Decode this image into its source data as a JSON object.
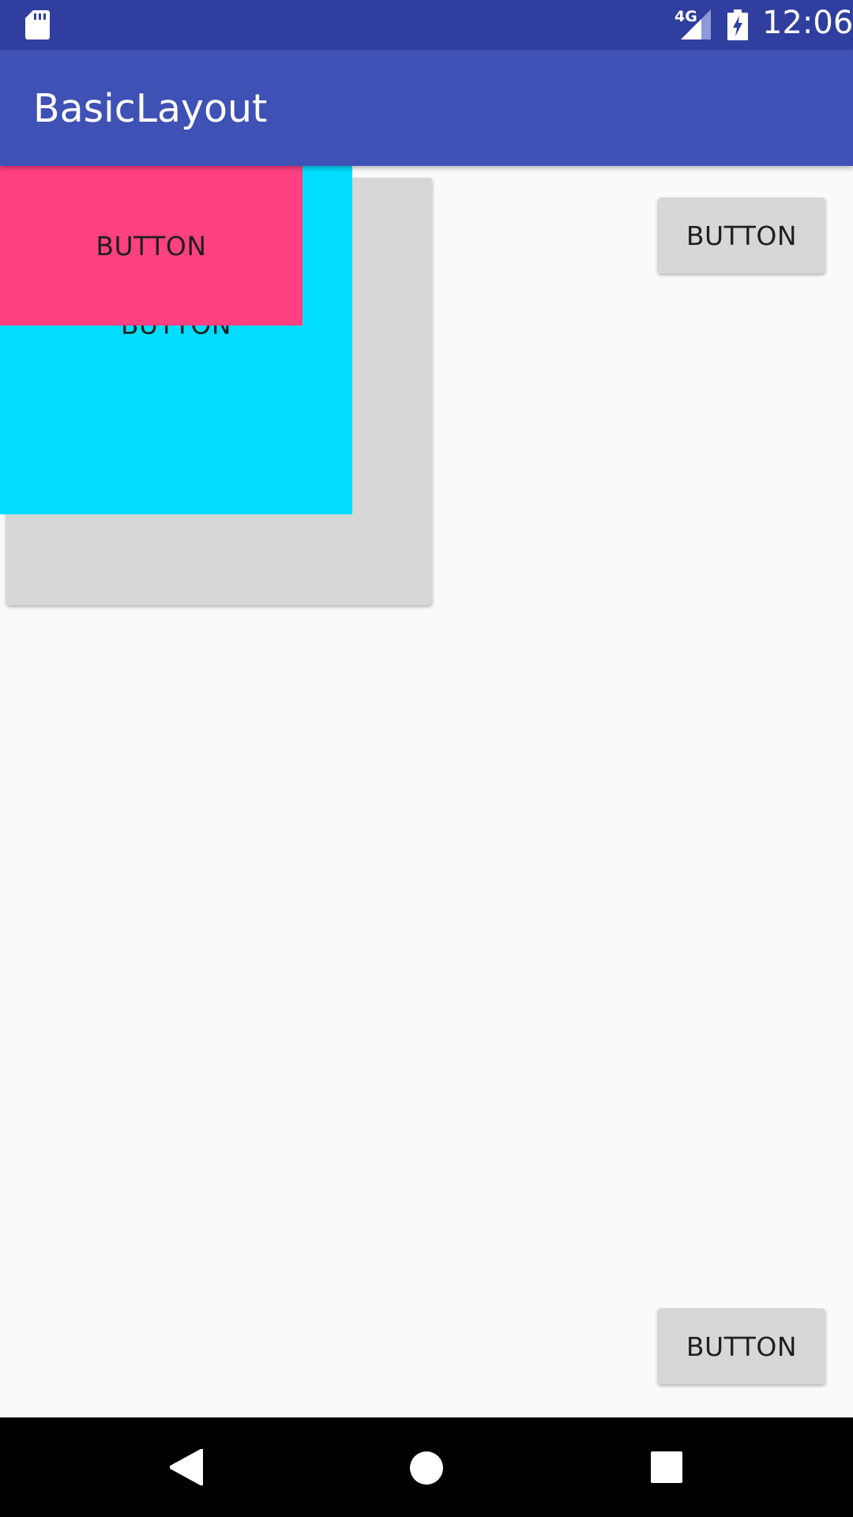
{
  "status_bar": {
    "time": "12:06",
    "network_label": "4G",
    "icons": [
      "sd-card-icon",
      "signal-icon",
      "battery-charging-icon"
    ]
  },
  "app_bar": {
    "title": "BasicLayout"
  },
  "buttons": {
    "grey_large": "",
    "cyan": "BUTTON",
    "pink": "BUTTON",
    "top_right": "BUTTON",
    "bottom_right": "BUTTON"
  },
  "colors": {
    "status_bar": "#303F9F",
    "app_bar": "#3F51B5",
    "accent_pink": "#FF4081",
    "cyan": "#00DDFF",
    "button_grey": "#D6D7D7",
    "background": "#FAFAFA"
  },
  "nav_bar": {
    "icons": [
      "back-icon",
      "home-icon",
      "recents-icon"
    ]
  }
}
